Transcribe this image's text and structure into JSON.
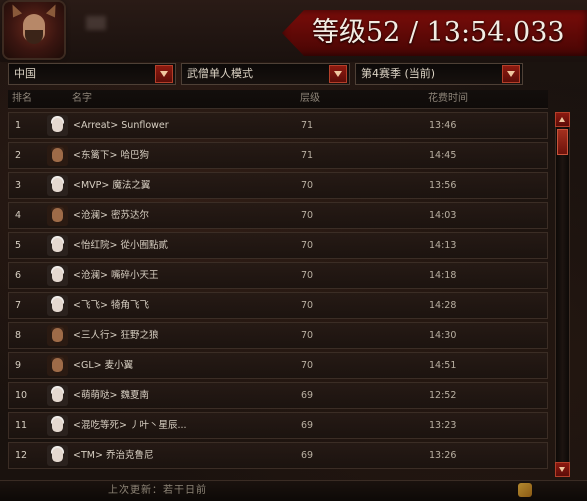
{
  "header": {
    "title": "等级52 / 13:54.033"
  },
  "filters": {
    "region": "中国",
    "class_mode": "武僧单人模式",
    "season": "第4赛季 (当前)"
  },
  "table": {
    "columns": {
      "rank": "排名",
      "name": "名字",
      "level": "层级",
      "time": "花费时间"
    },
    "rows": [
      {
        "rank": "1",
        "name": "<Arreat> Sunflower",
        "level": "71",
        "time": "13:46",
        "avatar": "monk-a"
      },
      {
        "rank": "2",
        "name": "<东篱下> 哈巴狗",
        "level": "71",
        "time": "14:45",
        "avatar": "monk-b"
      },
      {
        "rank": "3",
        "name": "<MVP> 魔法之翼",
        "level": "70",
        "time": "13:56",
        "avatar": "monk-a"
      },
      {
        "rank": "4",
        "name": "<沧澜> 密苏达尔",
        "level": "70",
        "time": "14:03",
        "avatar": "monk-b"
      },
      {
        "rank": "5",
        "name": "<怡红院> 從小囿點貳",
        "level": "70",
        "time": "14:13",
        "avatar": "monk-a"
      },
      {
        "rank": "6",
        "name": "<沧澜> 嘴碎小天王",
        "level": "70",
        "time": "14:18",
        "avatar": "monk-a"
      },
      {
        "rank": "7",
        "name": "<飞飞> 犄角飞飞",
        "level": "70",
        "time": "14:28",
        "avatar": "monk-a"
      },
      {
        "rank": "8",
        "name": "<三人行> 狂野之狼",
        "level": "70",
        "time": "14:30",
        "avatar": "monk-b"
      },
      {
        "rank": "9",
        "name": "<GL> 麦小翼",
        "level": "70",
        "time": "14:51",
        "avatar": "monk-b"
      },
      {
        "rank": "10",
        "name": "<萌萌哒> 魏夏南",
        "level": "69",
        "time": "12:52",
        "avatar": "monk-a"
      },
      {
        "rank": "11",
        "name": "<混吃等死> 丿叶丶星辰...",
        "level": "69",
        "time": "13:23",
        "avatar": "monk-a"
      },
      {
        "rank": "12",
        "name": "<TM> 乔治克鲁尼",
        "level": "69",
        "time": "13:26",
        "avatar": "monk-a"
      }
    ]
  },
  "footer": {
    "text": "上次更新：若干日前"
  },
  "colors": {
    "accent_red": "#7a0d0a",
    "button_red": "#8d1a10",
    "text_light": "#d7cfc2"
  }
}
